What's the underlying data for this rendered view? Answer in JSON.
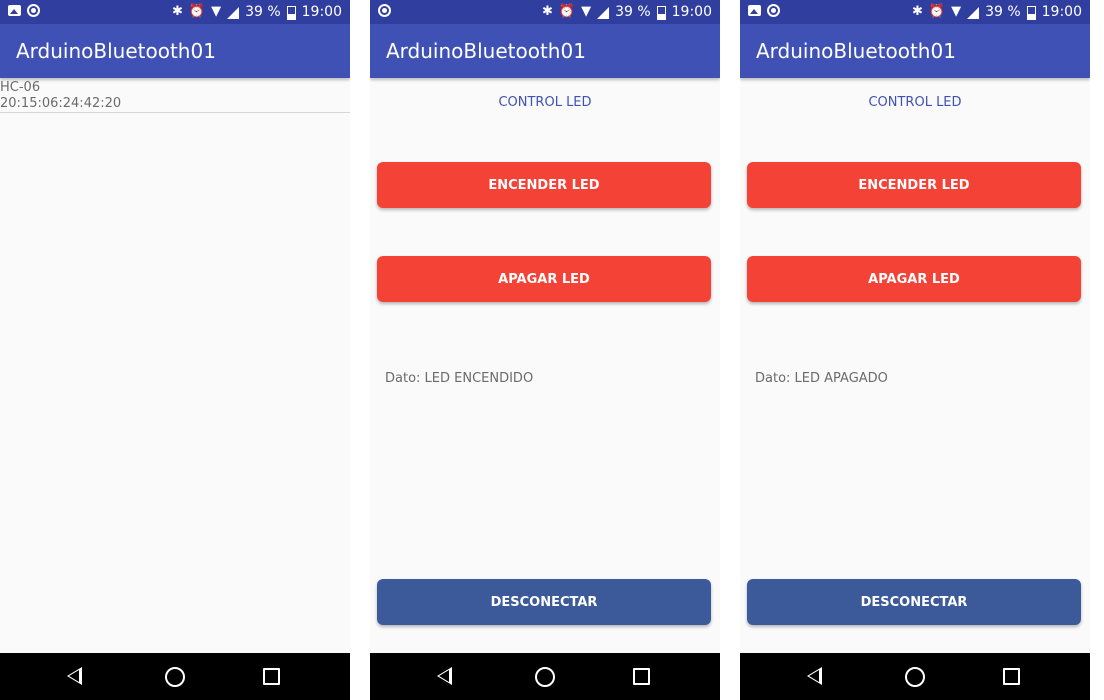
{
  "status_bar": {
    "battery": "39 %",
    "time": "19:00"
  },
  "app": {
    "title": "ArduinoBluetooth01"
  },
  "screens": [
    {
      "name": "device-list",
      "devices": [
        {
          "name": "HC-06",
          "address": "20:15:06:24:42:20"
        }
      ]
    },
    {
      "name": "control",
      "control_title": "CONTROL LED",
      "on_button": "ENCENDER LED",
      "off_button": "APAGAR LED",
      "dato": "Dato: LED ENCENDIDO",
      "disconnect_button": "DESCONECTAR"
    },
    {
      "name": "control",
      "control_title": "CONTROL LED",
      "on_button": "ENCENDER LED",
      "off_button": "APAGAR LED",
      "dato": "Dato: LED APAGADO",
      "disconnect_button": "DESCONECTAR"
    }
  ],
  "colors": {
    "status_bar": "#303f9f",
    "app_bar": "#3f51b5",
    "red_button": "#f44336",
    "disconnect_button": "#3c5a99",
    "nav_bar": "#000000"
  },
  "icons": {
    "status_left": [
      "image-notification-icon",
      "circle-notification-icon"
    ],
    "status_right": [
      "bluetooth-icon",
      "alarm-icon",
      "wifi-icon",
      "signal-icon",
      "battery-icon"
    ],
    "nav": [
      "back-icon",
      "home-icon",
      "recent-apps-icon"
    ]
  }
}
